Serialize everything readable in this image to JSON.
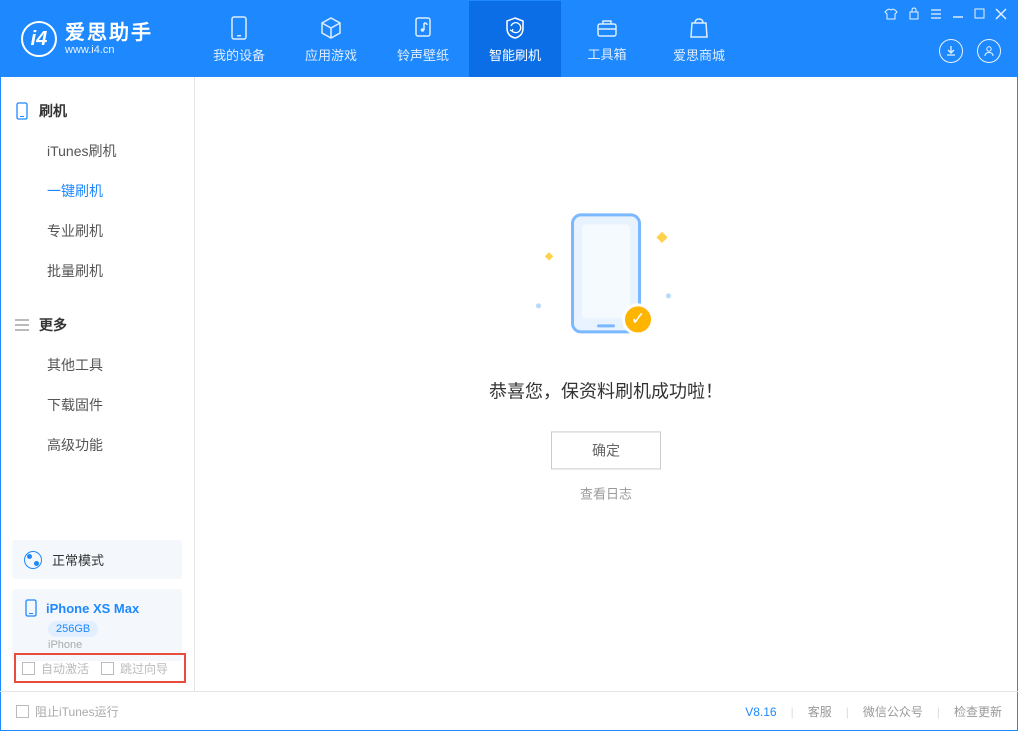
{
  "app": {
    "title": "爱思助手",
    "subtitle": "www.i4.cn"
  },
  "topTabs": {
    "device": "我的设备",
    "apps": "应用游戏",
    "rings": "铃声壁纸",
    "flash": "智能刷机",
    "tools": "工具箱",
    "store": "爱思商城"
  },
  "sidebar": {
    "flash_head": "刷机",
    "itunes_flash": "iTunes刷机",
    "one_click": "一键刷机",
    "pro_flash": "专业刷机",
    "batch_flash": "批量刷机",
    "more_head": "更多",
    "other_tools": "其他工具",
    "download_fw": "下载固件",
    "advanced": "高级功能"
  },
  "mode": {
    "label": "正常模式"
  },
  "device": {
    "name": "iPhone XS Max",
    "capacity": "256GB",
    "type": "iPhone"
  },
  "highlight": {
    "auto_activate": "自动激活",
    "skip_guide": "跳过向导"
  },
  "main": {
    "success_msg": "恭喜您，保资料刷机成功啦！",
    "ok": "确定",
    "view_log": "查看日志"
  },
  "footer": {
    "block_itunes": "阻止iTunes运行",
    "version": "V8.16",
    "support": "客服",
    "wechat": "微信公众号",
    "update": "检查更新"
  }
}
